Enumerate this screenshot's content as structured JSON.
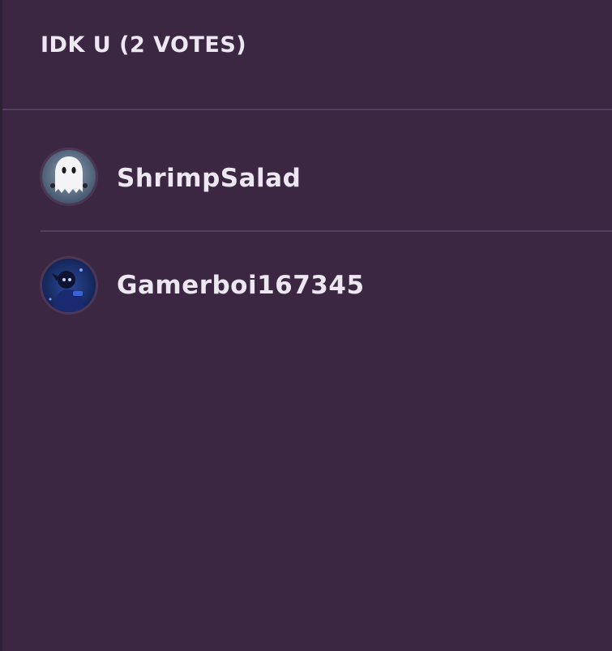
{
  "header": {
    "title": "IDK U (2 VOTES)"
  },
  "voters": [
    {
      "name": "ShrimpSalad",
      "avatar_icon": "ghost-avatar-icon"
    },
    {
      "name": "Gamerboi167345",
      "avatar_icon": "character-avatar-icon"
    }
  ],
  "colors": {
    "background": "#3b2742",
    "divider": "#56405e",
    "text": "#ece7f0"
  }
}
